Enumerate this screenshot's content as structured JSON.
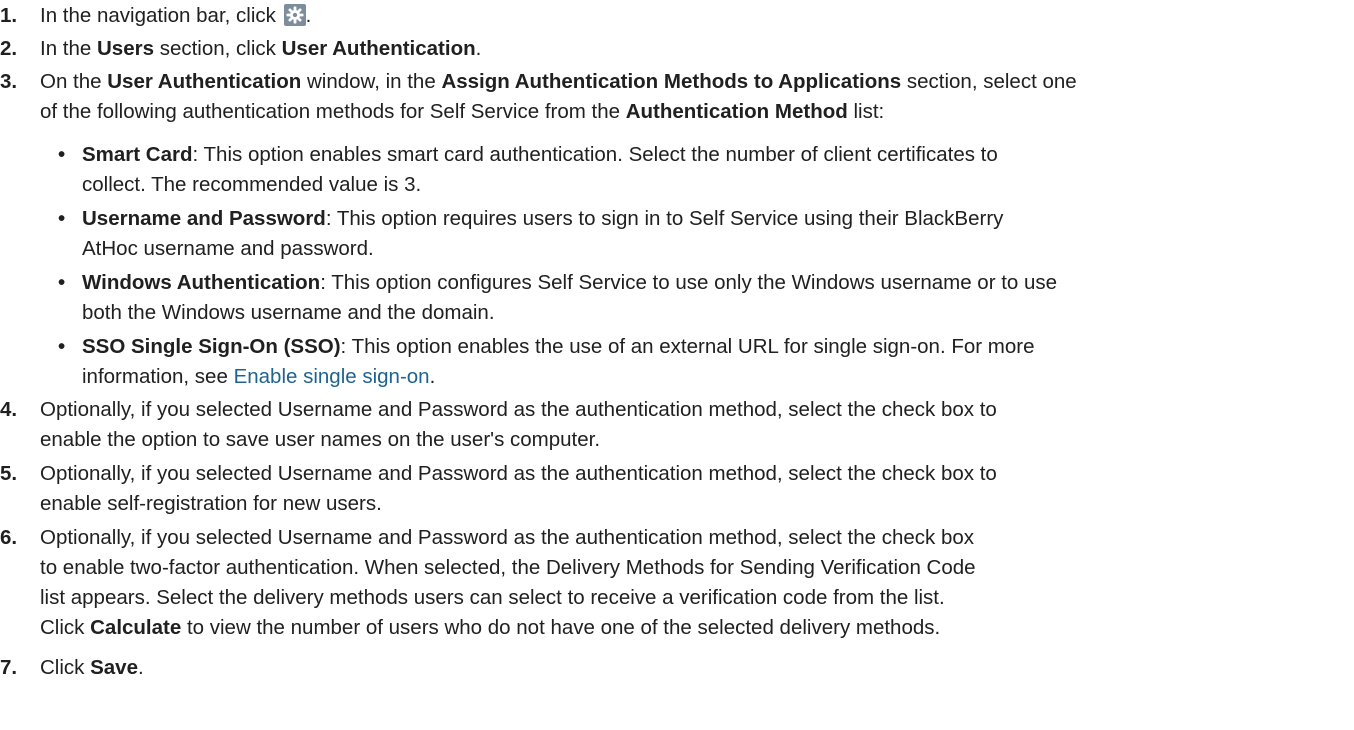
{
  "steps": [
    {
      "num": "1.",
      "text1": "In the navigation bar, click ",
      "text2": "."
    },
    {
      "num": "2.",
      "t1": "In the ",
      "b1": "Users",
      "t2": " section, click ",
      "b2": "User Authentication",
      "t3": "."
    },
    {
      "num": "3.",
      "t1": "On the ",
      "b1": "User Authentication",
      "t2": " window, in the ",
      "b2": "Assign Authentication Methods to Applications",
      "t3": " section, select one",
      "line2a": "of the following authentication methods for Self Service from the ",
      "b3": "Authentication Method",
      "line2b": " list:"
    },
    {
      "num": "4.",
      "line1": "Optionally, if you selected Username and Password as the authentication method, select the check box to",
      "line2": "enable the option to save user names on the user's computer."
    },
    {
      "num": "5.",
      "line1": "Optionally, if you selected Username and Password as the authentication method, select the check box to",
      "line2": "enable self-registration for new users."
    },
    {
      "num": "6.",
      "line1": "Optionally, if you selected Username and Password as the authentication method, select the check box",
      "line2": "to enable two-factor authentication. When selected, the Delivery Methods for Sending Verification Code",
      "line3": "list appears. Select the delivery methods users can select to receive a verification code from the list.",
      "line4a": "Click ",
      "b1": "Calculate",
      "line4b": " to view the number of users who do not have one of the selected delivery methods."
    },
    {
      "num": "7.",
      "t1": "Click ",
      "b1": "Save",
      "t2": "."
    }
  ],
  "bullets": [
    {
      "dot": "•",
      "bold": "Smart Card",
      "line1": ": This option enables smart card authentication. Select the number of client certificates to",
      "line2": "collect. The recommended value is 3."
    },
    {
      "dot": "•",
      "bold": "Username and Password",
      "line1": ": This option requires users to sign in to Self Service using their BlackBerry",
      "line2": "AtHoc username and password."
    },
    {
      "dot": "•",
      "bold": "Windows Authentication",
      "line1": ": This option configures Self Service to use only the Windows username or to use",
      "line2": "both the Windows username and the domain."
    },
    {
      "dot": "•",
      "bold": "SSO Single Sign-On (SSO)",
      "line1": ": This option enables the use of an external URL for single sign-on. For more",
      "line2a": "information, see ",
      "link": "Enable single sign-on",
      "line2b": "."
    }
  ],
  "icons": {
    "settings": "gear-icon"
  },
  "colors": {
    "text": "#202020",
    "link": "#1f6391",
    "icon_bg": "#7d8d9c"
  }
}
